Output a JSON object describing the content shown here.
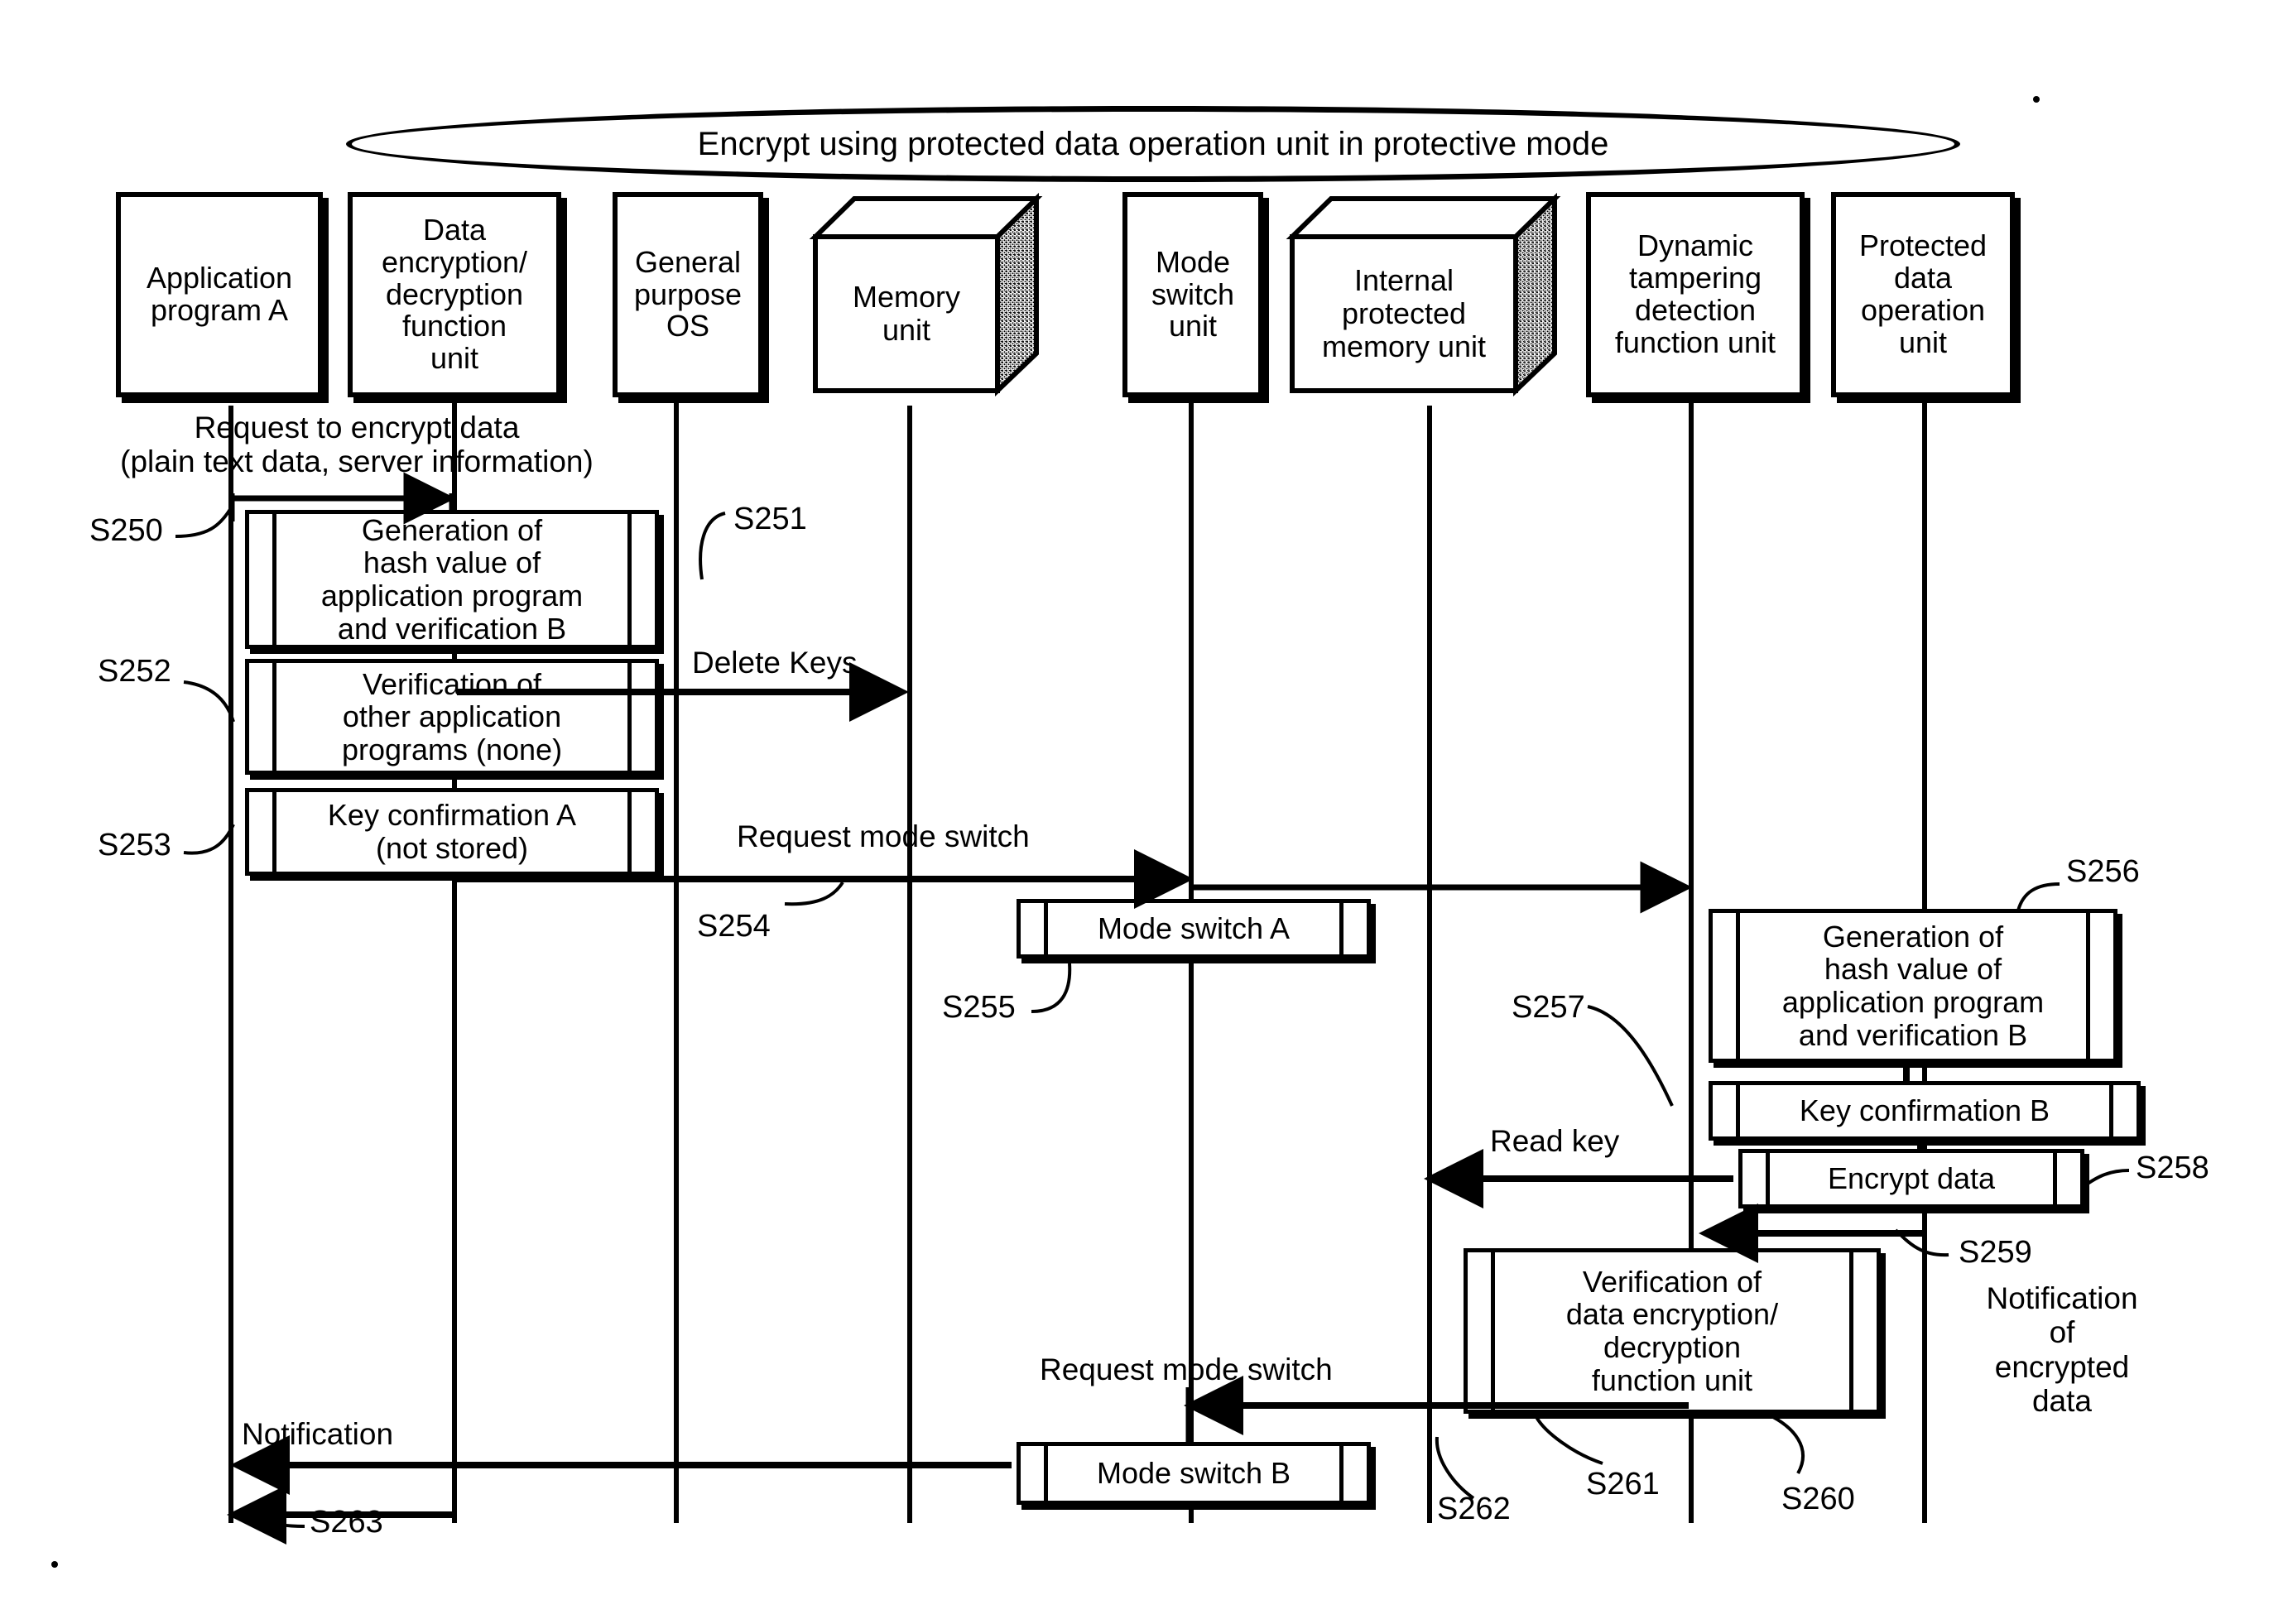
{
  "figure": {
    "title": "Encrypt using protected data operation unit in protective mode",
    "type": "sequence-diagram"
  },
  "participants": [
    {
      "id": "application-program-a",
      "label": "Application\nprogram A",
      "shape": "box"
    },
    {
      "id": "data-encryption-decryption-function-unit",
      "label": "Data\nencryption/\ndecryption\nfunction\nunit",
      "shape": "box"
    },
    {
      "id": "general-purpose-os",
      "label": "General\npurpose\nOS",
      "shape": "box"
    },
    {
      "id": "memory-unit",
      "label": "Memory\nunit",
      "shape": "cube"
    },
    {
      "id": "mode-switch-unit",
      "label": "Mode\nswitch\nunit",
      "shape": "box"
    },
    {
      "id": "internal-protected-memory-unit",
      "label": "Internal\nprotected\nmemory unit",
      "shape": "cube"
    },
    {
      "id": "dynamic-tampering-detection-function-unit",
      "label": "Dynamic\ntampering\ndetection\nfunction unit",
      "shape": "box"
    },
    {
      "id": "protected-data-operation-unit",
      "label": "Protected\ndata\noperation\nunit",
      "shape": "box"
    }
  ],
  "messages": [
    {
      "id": "request-to-encrypt-data",
      "label": "Request to encrypt data\n(plain text data, server information)",
      "step": "S250"
    },
    {
      "id": "delete-keys",
      "label": "Delete Keys",
      "step": "S251"
    },
    {
      "id": "request-mode-switch-1",
      "label": "Request mode switch",
      "step": "S254"
    },
    {
      "id": "read-key",
      "label": "Read key",
      "step": "S257"
    },
    {
      "id": "notification-of-encrypted-data",
      "label": "Notification\nof\nencrypted\ndata",
      "step": "S259"
    },
    {
      "id": "request-mode-switch-2",
      "label": "Request mode switch",
      "step": "S262"
    },
    {
      "id": "notification",
      "label": "Notification",
      "step": "S263"
    }
  ],
  "actions": [
    {
      "id": "generation-of-hash-value-a",
      "label": "Generation of\nhash value of\napplication program\nand verification B",
      "step": "S250"
    },
    {
      "id": "verification-of-other-application-programs",
      "label": "Verification of\nother application\nprograms (none)",
      "step": "S252"
    },
    {
      "id": "key-confirmation-a",
      "label": "Key confirmation A\n(not  stored)",
      "step": "S253"
    },
    {
      "id": "mode-switch-a",
      "label": "Mode switch A",
      "step": "S255"
    },
    {
      "id": "generation-of-hash-value-b",
      "label": "Generation of\nhash value of\napplication program\nand verification B",
      "step": "S256"
    },
    {
      "id": "key-confirmation-b",
      "label": "Key confirmation B",
      "step": "S257"
    },
    {
      "id": "encrypt-data",
      "label": "Encrypt data",
      "step": "S258"
    },
    {
      "id": "verification-of-data-encryption-decryption-function-unit",
      "label": "Verification of\ndata encryption/\ndecryption\nfunction unit",
      "step": "S261"
    },
    {
      "id": "mode-switch-b",
      "label": "Mode switch B",
      "step": "S262"
    }
  ],
  "step_labels": {
    "s250": "S250",
    "s251": "S251",
    "s252": "S252",
    "s253": "S253",
    "s254": "S254",
    "s255": "S255",
    "s256": "S256",
    "s257": "S257",
    "s258": "S258",
    "s259": "S259",
    "s260": "S260",
    "s261": "S261",
    "s262": "S262",
    "s263": "S263"
  },
  "text_labels": {
    "request_encrypt": "Request to encrypt data\n(plain text data, server information)",
    "delete_keys": "Delete Keys",
    "request_mode_switch_1": "Request mode switch",
    "read_key": "Read key",
    "notification_encrypted_data": "Notification\nof\nencrypted\ndata",
    "request_mode_switch_2": "Request mode switch",
    "notification": "Notification"
  },
  "colors": {
    "stroke": "#000000",
    "background": "#ffffff",
    "cube_face_fill": "#dcdcdc"
  }
}
